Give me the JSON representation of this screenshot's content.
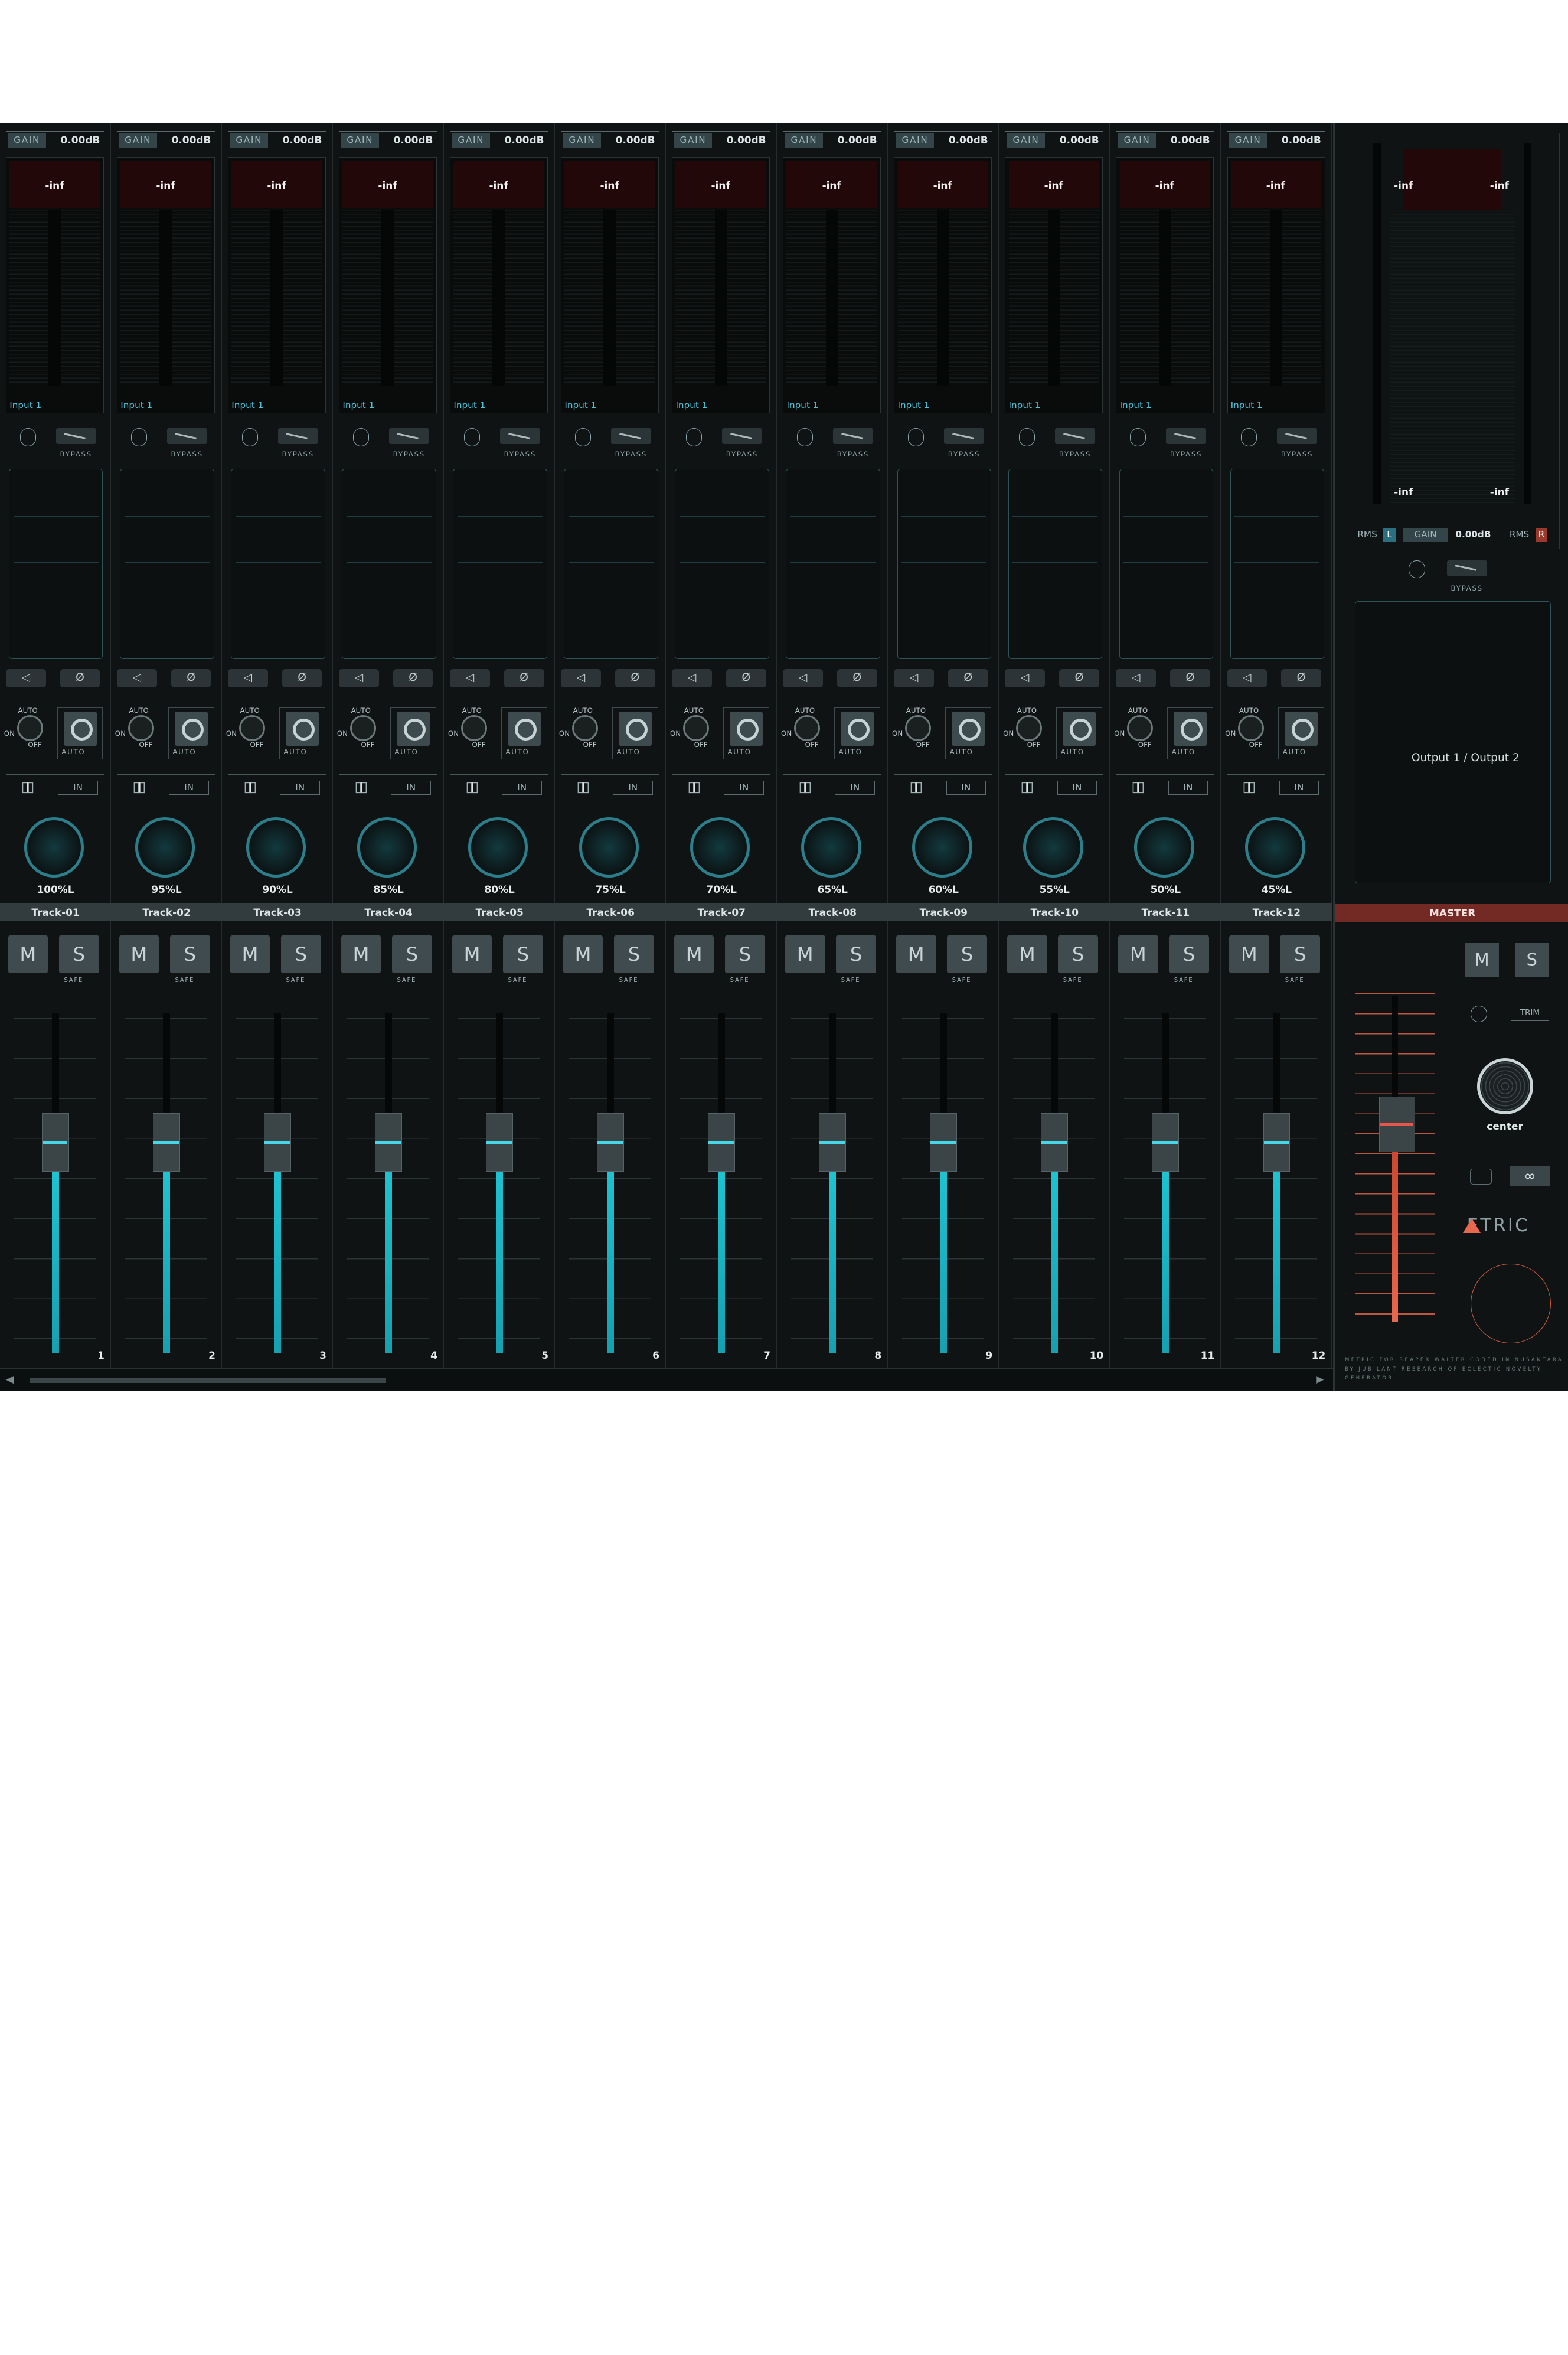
{
  "tracks": [
    {
      "gain_label": "GAIN",
      "gain": "0.00dB",
      "peak": "-inf",
      "input": "Input 1",
      "bypass": "BYPASS",
      "auto": "AUTO",
      "on": "ON",
      "off": "OFF",
      "rec_auto": "AUTO",
      "in": "IN",
      "pan": "100%L",
      "name": "Track-01",
      "m": "M",
      "s": "S",
      "safe": "SAFE",
      "number": "1"
    },
    {
      "gain_label": "GAIN",
      "gain": "0.00dB",
      "peak": "-inf",
      "input": "Input 1",
      "bypass": "BYPASS",
      "auto": "AUTO",
      "on": "ON",
      "off": "OFF",
      "rec_auto": "AUTO",
      "in": "IN",
      "pan": "95%L",
      "name": "Track-02",
      "m": "M",
      "s": "S",
      "safe": "SAFE",
      "number": "2"
    },
    {
      "gain_label": "GAIN",
      "gain": "0.00dB",
      "peak": "-inf",
      "input": "Input 1",
      "bypass": "BYPASS",
      "auto": "AUTO",
      "on": "ON",
      "off": "OFF",
      "rec_auto": "AUTO",
      "in": "IN",
      "pan": "90%L",
      "name": "Track-03",
      "m": "M",
      "s": "S",
      "safe": "SAFE",
      "number": "3"
    },
    {
      "gain_label": "GAIN",
      "gain": "0.00dB",
      "peak": "-inf",
      "input": "Input 1",
      "bypass": "BYPASS",
      "auto": "AUTO",
      "on": "ON",
      "off": "OFF",
      "rec_auto": "AUTO",
      "in": "IN",
      "pan": "85%L",
      "name": "Track-04",
      "m": "M",
      "s": "S",
      "safe": "SAFE",
      "number": "4"
    },
    {
      "gain_label": "GAIN",
      "gain": "0.00dB",
      "peak": "-inf",
      "input": "Input 1",
      "bypass": "BYPASS",
      "auto": "AUTO",
      "on": "ON",
      "off": "OFF",
      "rec_auto": "AUTO",
      "in": "IN",
      "pan": "80%L",
      "name": "Track-05",
      "m": "M",
      "s": "S",
      "safe": "SAFE",
      "number": "5"
    },
    {
      "gain_label": "GAIN",
      "gain": "0.00dB",
      "peak": "-inf",
      "input": "Input 1",
      "bypass": "BYPASS",
      "auto": "AUTO",
      "on": "ON",
      "off": "OFF",
      "rec_auto": "AUTO",
      "in": "IN",
      "pan": "75%L",
      "name": "Track-06",
      "m": "M",
      "s": "S",
      "safe": "SAFE",
      "number": "6"
    },
    {
      "gain_label": "GAIN",
      "gain": "0.00dB",
      "peak": "-inf",
      "input": "Input 1",
      "bypass": "BYPASS",
      "auto": "AUTO",
      "on": "ON",
      "off": "OFF",
      "rec_auto": "AUTO",
      "in": "IN",
      "pan": "70%L",
      "name": "Track-07",
      "m": "M",
      "s": "S",
      "safe": "SAFE",
      "number": "7"
    },
    {
      "gain_label": "GAIN",
      "gain": "0.00dB",
      "peak": "-inf",
      "input": "Input 1",
      "bypass": "BYPASS",
      "auto": "AUTO",
      "on": "ON",
      "off": "OFF",
      "rec_auto": "AUTO",
      "in": "IN",
      "pan": "65%L",
      "name": "Track-08",
      "m": "M",
      "s": "S",
      "safe": "SAFE",
      "number": "8"
    },
    {
      "gain_label": "GAIN",
      "gain": "0.00dB",
      "peak": "-inf",
      "input": "Input 1",
      "bypass": "BYPASS",
      "auto": "AUTO",
      "on": "ON",
      "off": "OFF",
      "rec_auto": "AUTO",
      "in": "IN",
      "pan": "60%L",
      "name": "Track-09",
      "m": "M",
      "s": "S",
      "safe": "SAFE",
      "number": "9"
    },
    {
      "gain_label": "GAIN",
      "gain": "0.00dB",
      "peak": "-inf",
      "input": "Input 1",
      "bypass": "BYPASS",
      "auto": "AUTO",
      "on": "ON",
      "off": "OFF",
      "rec_auto": "AUTO",
      "in": "IN",
      "pan": "55%L",
      "name": "Track-10",
      "m": "M",
      "s": "S",
      "safe": "SAFE",
      "number": "10"
    },
    {
      "gain_label": "GAIN",
      "gain": "0.00dB",
      "peak": "-inf",
      "input": "Input 1",
      "bypass": "BYPASS",
      "auto": "AUTO",
      "on": "ON",
      "off": "OFF",
      "rec_auto": "AUTO",
      "in": "IN",
      "pan": "50%L",
      "name": "Track-11",
      "m": "M",
      "s": "S",
      "safe": "SAFE",
      "number": "11"
    },
    {
      "gain_label": "GAIN",
      "gain": "0.00dB",
      "peak": "-inf",
      "input": "Input 1",
      "bypass": "BYPASS",
      "auto": "AUTO",
      "on": "ON",
      "off": "OFF",
      "rec_auto": "AUTO",
      "in": "IN",
      "pan": "45%L",
      "name": "Track-12",
      "m": "M",
      "s": "S",
      "safe": "SAFE",
      "number": "12"
    }
  ],
  "master": {
    "peak_top_l": "-inf",
    "peak_top_r": "-inf",
    "peak_bottom_l": "-inf",
    "peak_bottom_r": "-inf",
    "rms_l": "RMS",
    "rms_l_badge": "L",
    "gain_label": "GAIN",
    "gain": "0.00dB",
    "rms_r": "RMS",
    "rms_r_badge": "R",
    "bypass": "BYPASS",
    "output": "Output 1 / Output 2",
    "name": "MASTER",
    "m": "M",
    "s": "S",
    "trim": "TRIM",
    "pan": "center",
    "link_glyph": "∞",
    "logo": "ETRIC",
    "footer": "METRIC FOR REAPER WALTER CODED IN NUSANTARA BY JUBILANT RESEARCH OF ECLECTIC NOVELTY GENERATOR"
  },
  "colors": {
    "accent": "#1ec4d2",
    "master_accent": "#e8674f",
    "background": "#0e1112"
  }
}
